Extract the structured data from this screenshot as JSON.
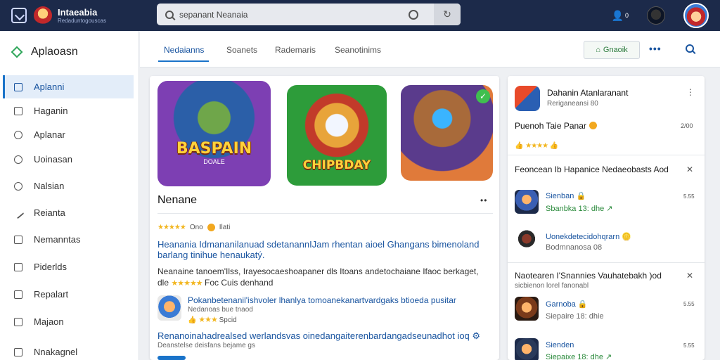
{
  "header": {
    "brand_title": "Intaeabia",
    "brand_subtitle": "Redaduntogouscas",
    "search_placeholder": "sepanant Neanaia",
    "user_count": "0"
  },
  "sidebar": {
    "title": "Aplaoasn",
    "items": [
      {
        "label": "Aplanni",
        "active": true
      },
      {
        "label": "Haganin"
      },
      {
        "label": "Aplanar"
      },
      {
        "label": "Uoinasan"
      },
      {
        "label": "Nalsian"
      },
      {
        "label": "Reianta"
      },
      {
        "label": "Nemanntas"
      },
      {
        "label": "Piderlds"
      },
      {
        "label": "Repalart"
      },
      {
        "label": "Majaon"
      },
      {
        "label": "Nnakagnel"
      }
    ]
  },
  "tabs": {
    "items": [
      "Nedaianns",
      "Soanets",
      "Rademaris",
      "Seanotinims"
    ],
    "action_button": "Gnaoik"
  },
  "main": {
    "art": [
      {
        "title": "BASPAIN",
        "subtitle": "DOALE"
      },
      {
        "title": "CHIPBDAY"
      },
      {
        "title": ""
      }
    ],
    "heading": "Nenane",
    "rating_text": "Ono",
    "rating_extra": "Ilati",
    "description": "Heanania Idmananilanuad sdetanannIJam rhentan aioel Ghangans bimenoland barlang tinihue henaukatý.",
    "description2_line1": "Neanaine tanoem'Ilss, Irayesocaeshoapaner dls Itoans andetochaiane Ifaoc berkaget,",
    "description2_line2_prefix": "dle",
    "description2_line2_suffix": "Foc Cuis denhand",
    "review_title": "Pokanbetenanil'ishvoler lhanlya tomoanekanartvardgaks btioeda pusitar",
    "review_sub": "Nedanoas bue tnaod",
    "review_meta": "Spcid",
    "note": "Renanoinahadrealsed werlandsvas oinedangaiterenbardangadseunadhot ioq",
    "note_sub": "Deanstelse deisfans bejame gs"
  },
  "right_panel": {
    "app_title": "Dahanin Atanlaranant",
    "app_sub": "Reriganeansi 80",
    "featured_title": "Puenoh Taie Panar",
    "featured_value": "2/00",
    "section1": {
      "title": "Feoncean Ib Hapanice Nedaeobasts Aod",
      "items": [
        {
          "name": "Sienban",
          "detail": "Sbanbka 13: dhe",
          "value": "5.55"
        },
        {
          "name": "Uonekdetecidohqrarn",
          "detail": "Bodmnanosa 08",
          "value": ""
        }
      ]
    },
    "section2": {
      "title": "Naotearen I'Snannies Vauhatebakh )od",
      "sub": "sicbienon lorel fanonabl",
      "items": [
        {
          "name": "Garnoba",
          "detail": "Siepaire 18: dhie",
          "value": "5.55"
        },
        {
          "name": "Sienden",
          "detail": "Siepaixe 18: dhe",
          "value": "5.55"
        }
      ]
    }
  }
}
